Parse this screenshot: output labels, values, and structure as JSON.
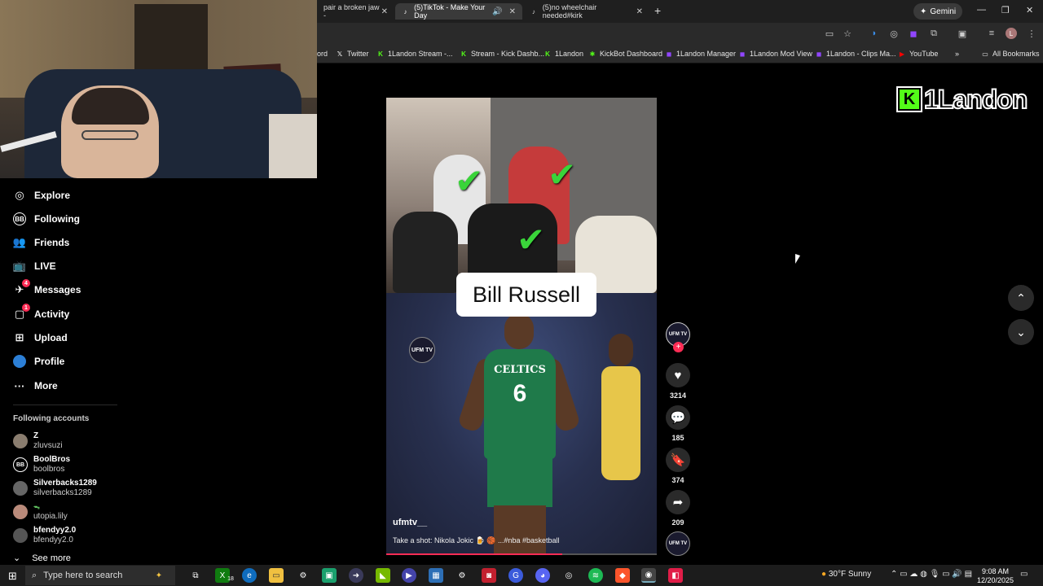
{
  "browser": {
    "tabs": [
      {
        "title": "pair a broken jaw -",
        "active": false
      },
      {
        "title": "(5)TikTok - Make Your Day",
        "active": true
      },
      {
        "title": "(5)no wheelchair needed#kirk",
        "active": false
      }
    ],
    "gemini_label": "Gemini",
    "bookmarks": [
      {
        "label": "ord",
        "icon": ""
      },
      {
        "label": "Twitter",
        "icon": "x-icon"
      },
      {
        "label": "1Landon Stream -...",
        "icon": "kick-icon"
      },
      {
        "label": "Stream - Kick Dashb...",
        "icon": "kick-icon"
      },
      {
        "label": "1Landon",
        "icon": "kick-icon"
      },
      {
        "label": "KickBot Dashboard",
        "icon": "bot-icon"
      },
      {
        "label": "1Landon Manager",
        "icon": "twitch-icon"
      },
      {
        "label": "1Landon Mod View",
        "icon": "twitch-icon"
      },
      {
        "label": "1Landon - Clips Ma...",
        "icon": "twitch-icon"
      },
      {
        "label": "YouTube",
        "icon": "youtube-icon"
      }
    ],
    "all_bookmarks": "All Bookmarks",
    "colors": {
      "tiktok_accent": "#fe2c55",
      "kick_green": "#53fc18"
    }
  },
  "sidebar": {
    "nav": [
      {
        "label": "Explore",
        "icon": "compass-icon",
        "badge": ""
      },
      {
        "label": "Following",
        "icon": "following-icon",
        "badge": ""
      },
      {
        "label": "Friends",
        "icon": "friends-icon",
        "badge": ""
      },
      {
        "label": "LIVE",
        "icon": "live-tv-icon",
        "badge": ""
      },
      {
        "label": "Messages",
        "icon": "paper-plane-icon",
        "badge": "4"
      },
      {
        "label": "Activity",
        "icon": "activity-icon",
        "badge": "1"
      },
      {
        "label": "Upload",
        "icon": "plus-square-icon",
        "badge": ""
      },
      {
        "label": "Profile",
        "icon": "avatar-icon",
        "badge": ""
      },
      {
        "label": "More",
        "icon": "ellipsis-icon",
        "badge": ""
      }
    ],
    "following_title": "Following accounts",
    "accounts": [
      {
        "name": "Z",
        "handle": "zluvsuzi"
      },
      {
        "name": "BoolBros",
        "handle": "boolbros"
      },
      {
        "name": "Silverbacks1289",
        "handle": "silverbacks1289"
      },
      {
        "name": "",
        "handle": "utopia.lily"
      },
      {
        "name": "bfendyy2.0",
        "handle": "bfendyy2.0"
      }
    ],
    "see_more": "See more"
  },
  "video": {
    "overlay_text": "Bill Russell",
    "watermark": "UFM TV",
    "jersey_text": "CELTICS",
    "jersey_number": "6",
    "author": "ufmtv__",
    "description": "Take a shot: Nikola Jokic 🍺 🏀 ...#nba #basketball",
    "progress": 0.65
  },
  "actions": {
    "creator_label": "UFM TV",
    "likes": "3214",
    "comments": "185",
    "saves": "374",
    "shares": "209"
  },
  "stream_overlay": {
    "name": "1Landon"
  },
  "taskbar": {
    "search_placeholder": "Type here to search",
    "xbox_badge": "18",
    "weather": "30°F  Sunny",
    "time": "9:08 AM",
    "date": "12/20/2025"
  }
}
